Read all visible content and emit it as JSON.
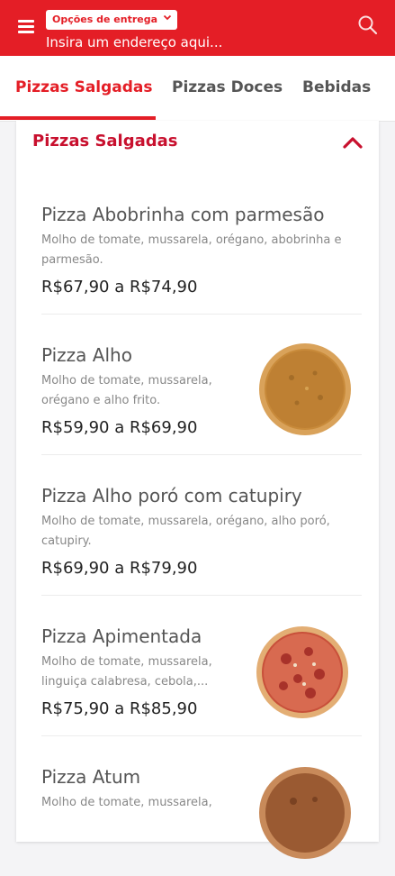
{
  "header": {
    "delivery_options_label": "Opções de entrega",
    "address_placeholder": "Insira um endereço aqui...",
    "background_color": "#e41e26"
  },
  "tabs": [
    {
      "label": "Pizzas Salgadas",
      "active": true
    },
    {
      "label": "Pizzas Doces",
      "active": false
    },
    {
      "label": "Bebidas",
      "active": false
    }
  ],
  "section": {
    "title": "Pizzas Salgadas",
    "expanded": true,
    "items": [
      {
        "name": "Pizza Abobrinha com parmesão",
        "description": "Molho de tomate, mussarela, orégano, abobrinha e parmesão.",
        "price": "R$67,90 a R$74,90",
        "has_image": false
      },
      {
        "name": "Pizza Alho",
        "description": "Molho de tomate, mussarela, orégano e alho frito.",
        "price": "R$59,90 a R$69,90",
        "has_image": true
      },
      {
        "name": "Pizza Alho poró com catupiry",
        "description": "Molho de tomate, mussarela, orégano, alho poró, catupiry.",
        "price": "R$69,90 a R$79,90",
        "has_image": false
      },
      {
        "name": "Pizza Apimentada",
        "description": "Molho de tomate, mussarela, linguiça calabresa, cebola,...",
        "price": "R$75,90 a R$85,90",
        "has_image": true
      },
      {
        "name": "Pizza Atum",
        "description": "Molho de tomate, mussarela,",
        "price": "",
        "has_image": true
      }
    ]
  },
  "icons": {
    "menu": "hamburger-icon",
    "delivery_dropdown": "chevron-down-icon",
    "search": "search-icon",
    "collapse": "chevron-up-icon"
  },
  "colors": {
    "accent": "#e41e26",
    "section_title": "#c8102e"
  }
}
